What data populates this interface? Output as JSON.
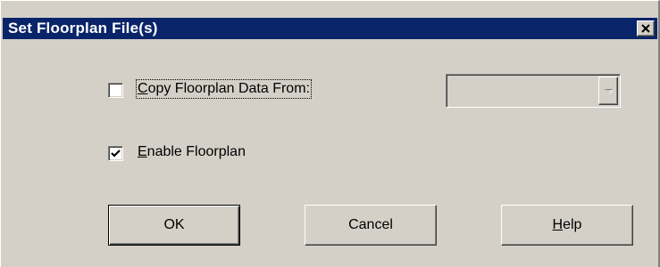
{
  "window": {
    "title": "Set Floorplan File(s)",
    "close_icon": "close-icon"
  },
  "copy_option": {
    "label_mnemonic": "C",
    "label_rest": "opy Floorplan Data From:",
    "checked": false
  },
  "enable_option": {
    "label_mnemonic": "E",
    "label_rest": "nable Floorplan",
    "checked": true
  },
  "source_dropdown": {
    "selected_value": "",
    "enabled": false,
    "arrow_icon": "chevron-down-icon"
  },
  "buttons": {
    "ok_label": "OK",
    "cancel_label": "Cancel",
    "help_mnemonic": "H",
    "help_rest": "elp"
  },
  "colors": {
    "titlebar": "#0a246a",
    "face": "#d4d0c8"
  }
}
